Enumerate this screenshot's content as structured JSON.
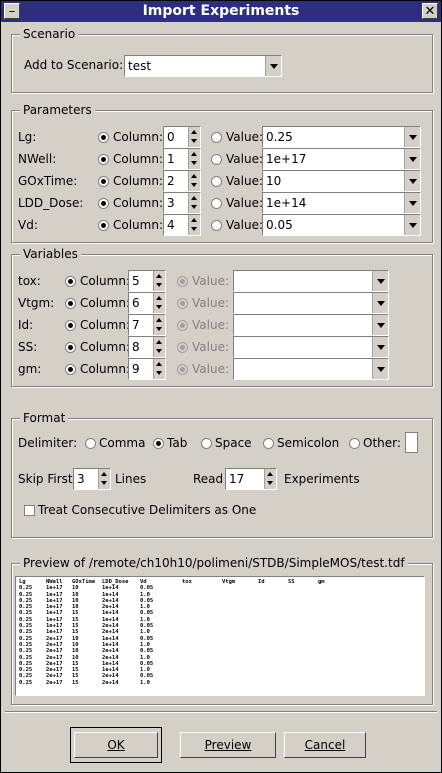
{
  "window": {
    "title": "Import Experiments"
  },
  "scenario": {
    "group_label": "Scenario",
    "add_label": "Add to Scenario:",
    "value": "test"
  },
  "parameters": {
    "group_label": "Parameters",
    "rows": [
      {
        "name": "Lg:",
        "column_label": "Column:",
        "column": "0",
        "value_label": "Value:",
        "value": "0.25"
      },
      {
        "name": "NWell:",
        "column_label": "Column:",
        "column": "1",
        "value_label": "Value:",
        "value": "1e+17"
      },
      {
        "name": "GOxTime:",
        "column_label": "Column:",
        "column": "2",
        "value_label": "Value:",
        "value": "10"
      },
      {
        "name": "LDD_Dose:",
        "column_label": "Column:",
        "column": "3",
        "value_label": "Value:",
        "value": "1e+14"
      },
      {
        "name": "Vd:",
        "column_label": "Column:",
        "column": "4",
        "value_label": "Value:",
        "value": "0.05"
      }
    ]
  },
  "variables": {
    "group_label": "Variables",
    "rows": [
      {
        "name": "tox:",
        "column_label": "Column:",
        "column": "5",
        "value_label": "Value:",
        "value": ""
      },
      {
        "name": "Vtgm:",
        "column_label": "Column:",
        "column": "6",
        "value_label": "Value:",
        "value": ""
      },
      {
        "name": "Id:",
        "column_label": "Column:",
        "column": "7",
        "value_label": "Value:",
        "value": ""
      },
      {
        "name": "SS:",
        "column_label": "Column:",
        "column": "8",
        "value_label": "Value:",
        "value": ""
      },
      {
        "name": "gm:",
        "column_label": "Column:",
        "column": "9",
        "value_label": "Value:",
        "value": ""
      }
    ]
  },
  "format": {
    "group_label": "Format",
    "delimiter_label": "Delimiter:",
    "delimiters": [
      "Comma",
      "Tab",
      "Space",
      "Semicolon",
      "Other:"
    ],
    "selected_delimiter": "Tab",
    "skip_first_label": "Skip First",
    "skip_first": "3",
    "lines_label": "Lines",
    "read_label": "Read",
    "read": "17",
    "experiments_label": "Experiments",
    "treat_consecutive_label": "Treat Consecutive Delimiters as One"
  },
  "preview": {
    "group_label": "Preview of /remote/ch10h10/polimeni/STDB/SimpleMOS/test.tdf",
    "header": [
      "Lg",
      "NWell",
      "GOxTime",
      "LDD_Dose",
      "Vd",
      "tox",
      "Vtgm",
      "Id",
      "SS",
      "gm"
    ],
    "rows": [
      [
        "0.25",
        "1e+17",
        "10",
        "1e+14",
        "0.05"
      ],
      [
        "0.25",
        "1e+17",
        "10",
        "1e+14",
        "1.0"
      ],
      [
        "0.25",
        "1e+17",
        "10",
        "2e+14",
        "0.05"
      ],
      [
        "0.25",
        "1e+17",
        "10",
        "2e+14",
        "1.0"
      ],
      [
        "0.25",
        "1e+17",
        "15",
        "1e+14",
        "0.05"
      ],
      [
        "0.25",
        "1e+17",
        "15",
        "1e+14",
        "1.0"
      ],
      [
        "0.25",
        "1e+17",
        "15",
        "2e+14",
        "0.05"
      ],
      [
        "0.25",
        "1e+17",
        "15",
        "2e+14",
        "1.0"
      ],
      [
        "0.25",
        "2e+17",
        "10",
        "1e+14",
        "0.05"
      ],
      [
        "0.25",
        "2e+17",
        "10",
        "1e+14",
        "1.0"
      ],
      [
        "0.25",
        "2e+17",
        "10",
        "2e+14",
        "0.05"
      ],
      [
        "0.25",
        "2e+17",
        "10",
        "2e+14",
        "1.0"
      ],
      [
        "0.25",
        "2e+17",
        "15",
        "1e+14",
        "0.05"
      ],
      [
        "0.25",
        "2e+17",
        "15",
        "1e+14",
        "1.0"
      ],
      [
        "0.25",
        "2e+17",
        "15",
        "2e+14",
        "0.05"
      ],
      [
        "0.25",
        "2e+17",
        "15",
        "2e+14",
        "1.0"
      ]
    ]
  },
  "buttons": {
    "ok": "OK",
    "preview": "Preview",
    "cancel": "Cancel"
  }
}
